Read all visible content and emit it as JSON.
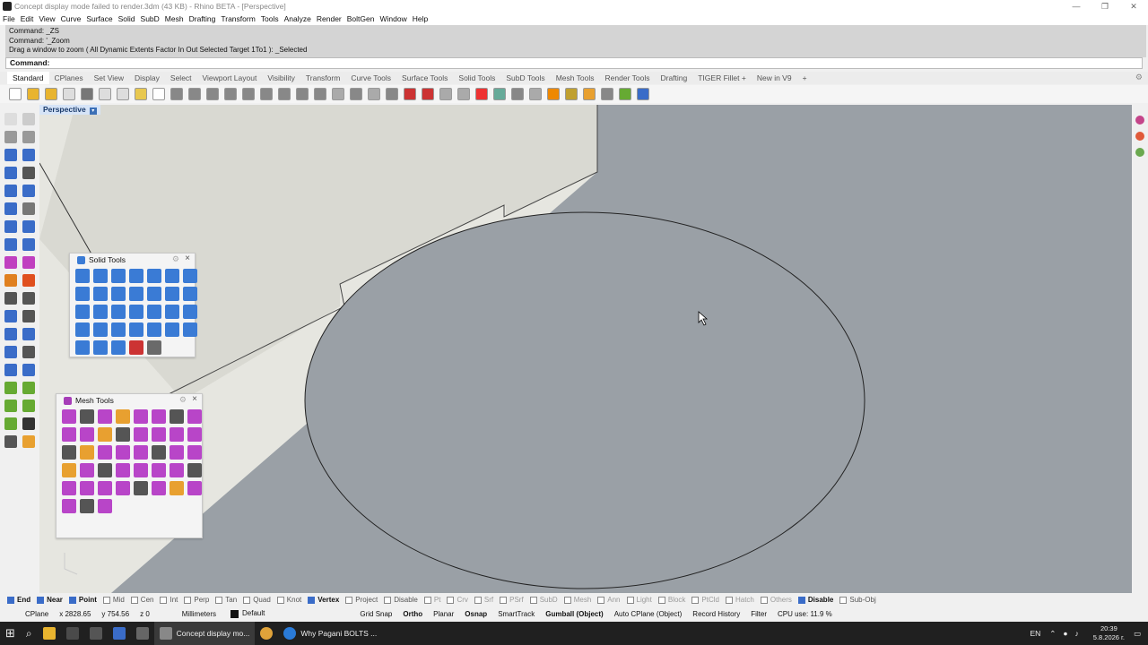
{
  "window": {
    "title": "Concept display mode failed to render.3dm (43 KB) - Rhino BETA - [Perspective]"
  },
  "menu": [
    "File",
    "Edit",
    "View",
    "Curve",
    "Surface",
    "Solid",
    "SubD",
    "Mesh",
    "Drafting",
    "Transform",
    "Tools",
    "Analyze",
    "Render",
    "BoltGen",
    "Window",
    "Help"
  ],
  "command_history": [
    "Command: _ZS",
    "Command: '_Zoom",
    "Drag a window to zoom ( All  Dynamic  Extents  Factor  In  Out  Selected  Target  1To1 ): _Selected"
  ],
  "command_prompt": "Command:",
  "toolbar_tabs": [
    "Standard",
    "CPlanes",
    "Set View",
    "Display",
    "Select",
    "Viewport Layout",
    "Visibility",
    "Transform",
    "Curve Tools",
    "Surface Tools",
    "Solid Tools",
    "SubD Tools",
    "Mesh Tools",
    "Render Tools",
    "Drafting",
    "TIGER Fillet +",
    "New in V9",
    "+"
  ],
  "viewport": {
    "label": "Perspective",
    "dropdown": "▾"
  },
  "panels": {
    "solid_tools": {
      "title": "Solid Tools"
    },
    "mesh_tools": {
      "title": "Mesh Tools"
    }
  },
  "osnaps": [
    {
      "label": "End",
      "state": "on"
    },
    {
      "label": "Near",
      "state": "on"
    },
    {
      "label": "Point",
      "state": "on"
    },
    {
      "label": "Mid",
      "state": "off"
    },
    {
      "label": "Cen",
      "state": "off"
    },
    {
      "label": "Int",
      "state": "off"
    },
    {
      "label": "Perp",
      "state": "off"
    },
    {
      "label": "Tan",
      "state": "off"
    },
    {
      "label": "Quad",
      "state": "off"
    },
    {
      "label": "Knot",
      "state": "off"
    },
    {
      "label": "Vertex",
      "state": "on"
    },
    {
      "label": "Project",
      "state": "off"
    },
    {
      "label": "Disable",
      "state": "off"
    },
    {
      "label": "Pt",
      "state": "dim"
    },
    {
      "label": "Crv",
      "state": "dim"
    },
    {
      "label": "Srf",
      "state": "dim"
    },
    {
      "label": "PSrf",
      "state": "dim"
    },
    {
      "label": "SubD",
      "state": "dim"
    },
    {
      "label": "Mesh",
      "state": "dim"
    },
    {
      "label": "Ann",
      "state": "dim"
    },
    {
      "label": "Light",
      "state": "dim"
    },
    {
      "label": "Block",
      "state": "dim"
    },
    {
      "label": "PtCld",
      "state": "dim"
    },
    {
      "label": "Hatch",
      "state": "dim"
    },
    {
      "label": "Others",
      "state": "dim"
    },
    {
      "label": "Disable",
      "state": "on"
    },
    {
      "label": "Sub-Obj",
      "state": "off"
    }
  ],
  "status": {
    "cplane": "CPlane",
    "x": "x 2828.65",
    "y": "y 754.56",
    "z": "z 0",
    "units": "Millimeters",
    "layer": "Default",
    "grid_snap": "Grid Snap",
    "ortho": "Ortho",
    "planar": "Planar",
    "osnap": "Osnap",
    "smarttrack": "SmartTrack",
    "gumball": "Gumball (Object)",
    "auto_cplane": "Auto CPlane (Object)",
    "record_history": "Record History",
    "filter": "Filter",
    "cpu": "CPU use: 11.9 %"
  },
  "taskbar": {
    "items": [
      "Concept display mo...",
      "Why Pagani BOLTS ..."
    ],
    "lang": "EN",
    "time": "20:39",
    "date": "5.8.2026 г."
  },
  "colors": {
    "viewport_bg": "#9aa0a6",
    "accent": "#3a6cc8",
    "taskbar": "#202020"
  }
}
